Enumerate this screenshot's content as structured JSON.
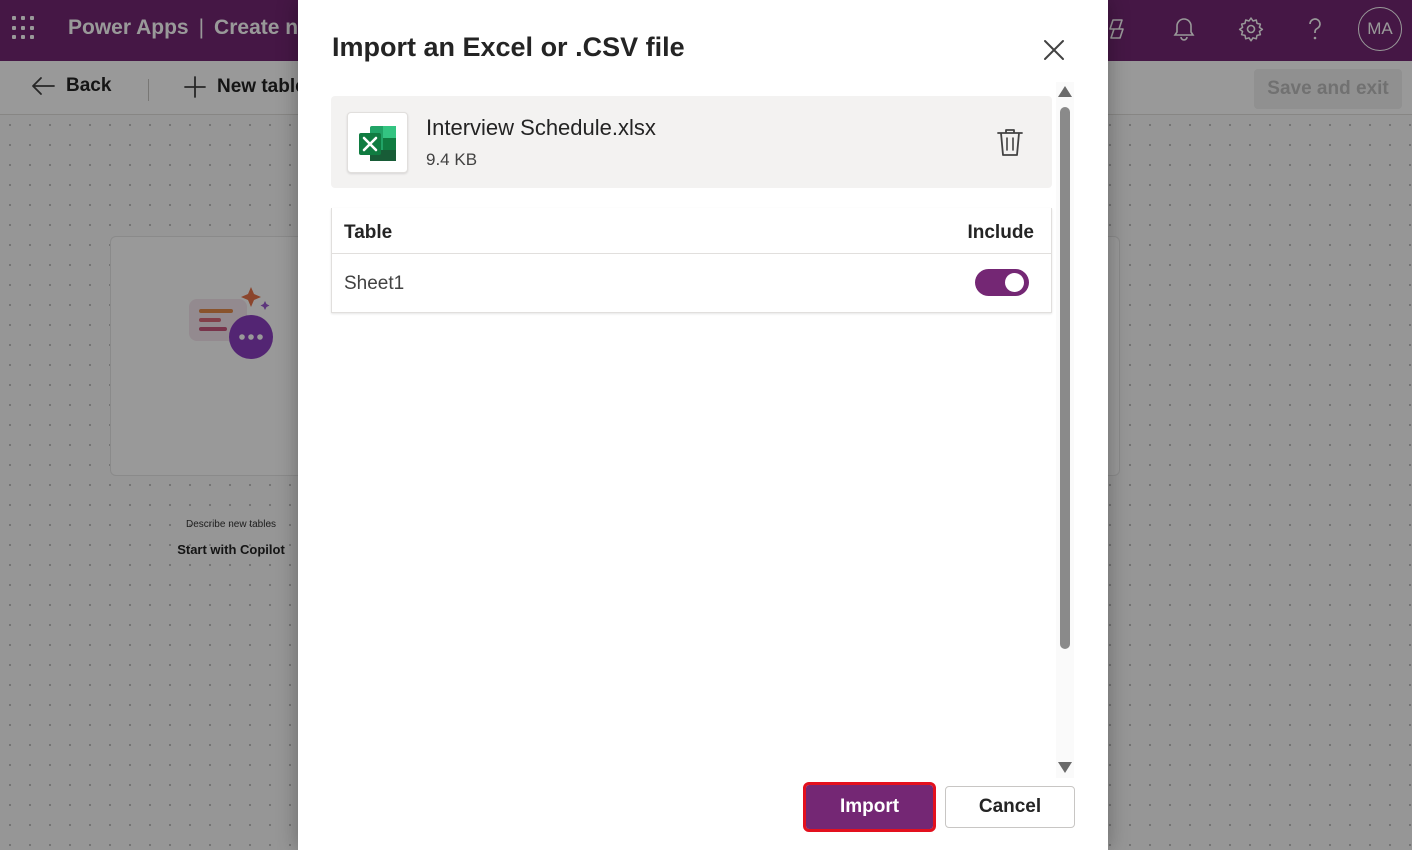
{
  "header": {
    "app_name": "Power Apps",
    "separator": "|",
    "page_title_partial": "Create ne",
    "avatar_initials": "MA"
  },
  "command_bar": {
    "back_label": "Back",
    "new_table_label": "New table",
    "save_exit_label": "Save and exit"
  },
  "background_card": {
    "subtitle": "Describe new tables",
    "title": "Start with Copilot"
  },
  "dialog": {
    "title": "Import an Excel or .CSV file",
    "file": {
      "name": "Interview Schedule.xlsx",
      "size": "9.4 KB",
      "icon": "excel-icon"
    },
    "table": {
      "columns": [
        "Table",
        "Include"
      ],
      "rows": [
        {
          "name": "Sheet1",
          "include": true
        }
      ]
    },
    "import_label": "Import",
    "cancel_label": "Cancel"
  },
  "colors": {
    "brand": "#742774",
    "highlight": "#e3101e"
  }
}
